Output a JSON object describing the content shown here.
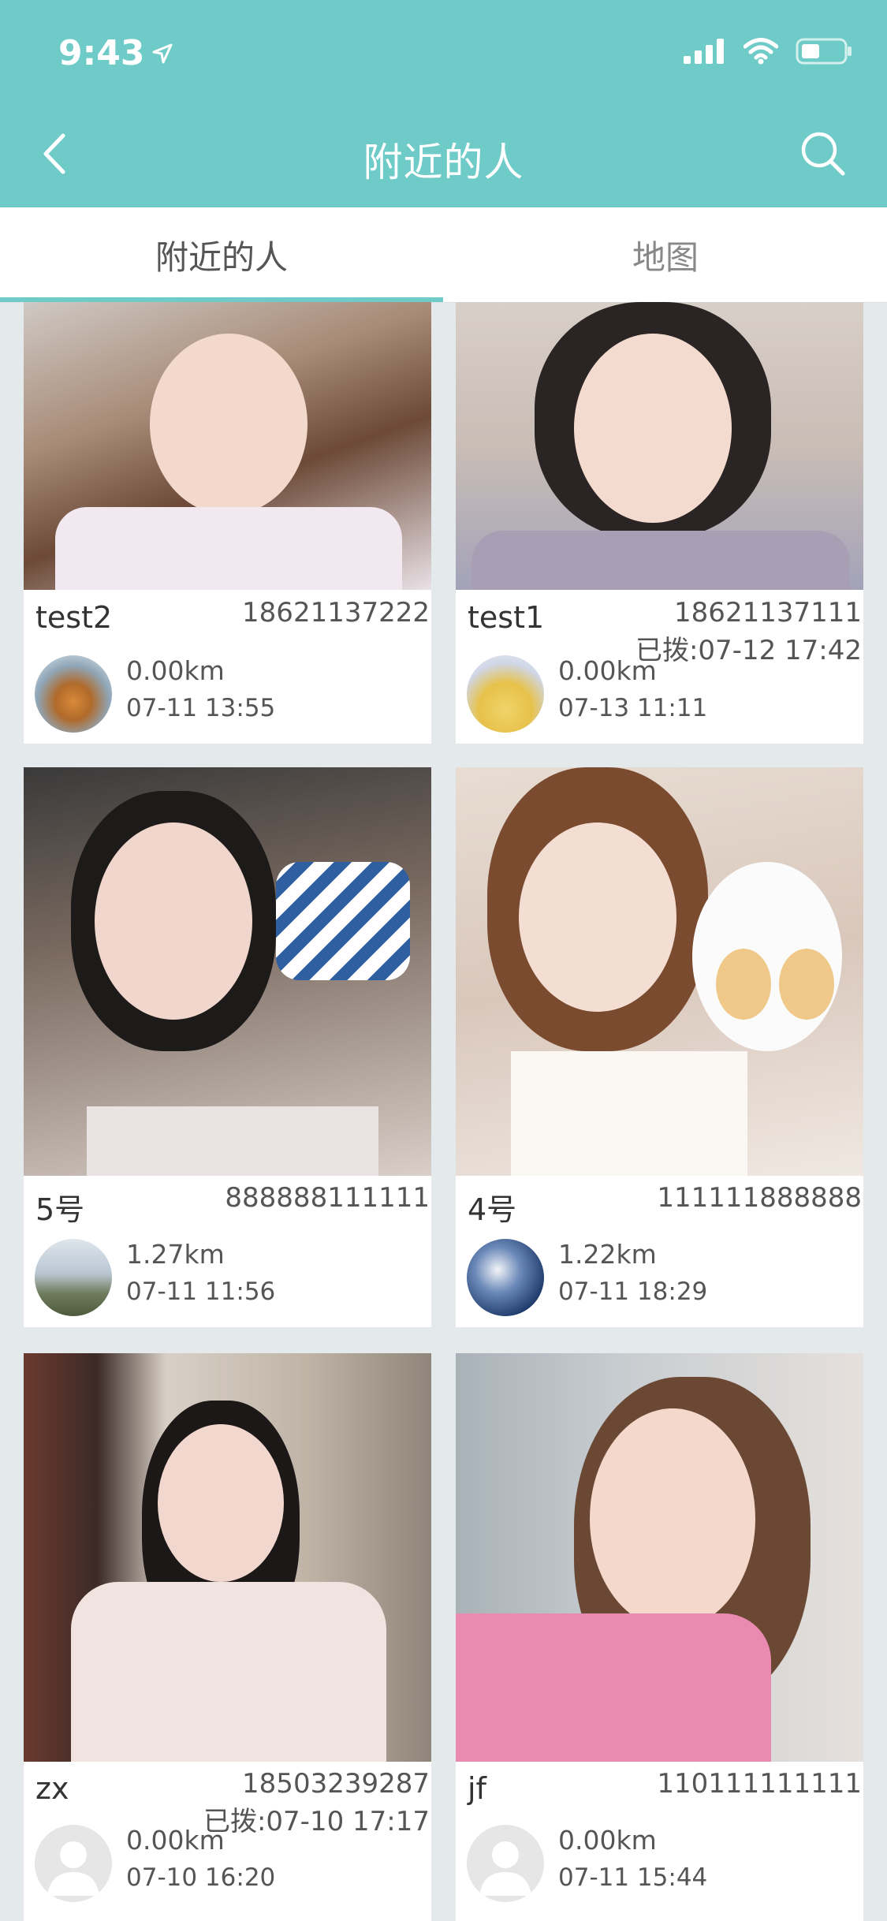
{
  "status_bar": {
    "time": "9:43"
  },
  "nav": {
    "title": "附近的人"
  },
  "tabs": [
    {
      "label": "附近的人",
      "active": true
    },
    {
      "label": "地图",
      "active": false
    }
  ],
  "colors": {
    "accent": "#6ecbc7",
    "background": "#e4eaec",
    "text": "#555555"
  },
  "cards": [
    {
      "name": "test2",
      "phone": "18621137222",
      "called": "",
      "distance": "0.00km",
      "time": "07-11 13:55"
    },
    {
      "name": "test1",
      "phone": "18621137111",
      "called": "已拨:07-12 17:42",
      "distance": "0.00km",
      "time": "07-13 11:11"
    },
    {
      "name": "5号",
      "phone": "888888111111",
      "called": "",
      "distance": "1.27km",
      "time": "07-11 11:56"
    },
    {
      "name": "4号",
      "phone": "111111888888",
      "called": "",
      "distance": "1.22km",
      "time": "07-11 18:29"
    },
    {
      "name": "zx",
      "phone": "18503239287",
      "called": "已拨:07-10 17:17",
      "distance": "0.00km",
      "time": "07-10 16:20"
    },
    {
      "name": "jf",
      "phone": "110111111111",
      "called": "",
      "distance": "0.00km",
      "time": "07-11 15:44"
    }
  ]
}
